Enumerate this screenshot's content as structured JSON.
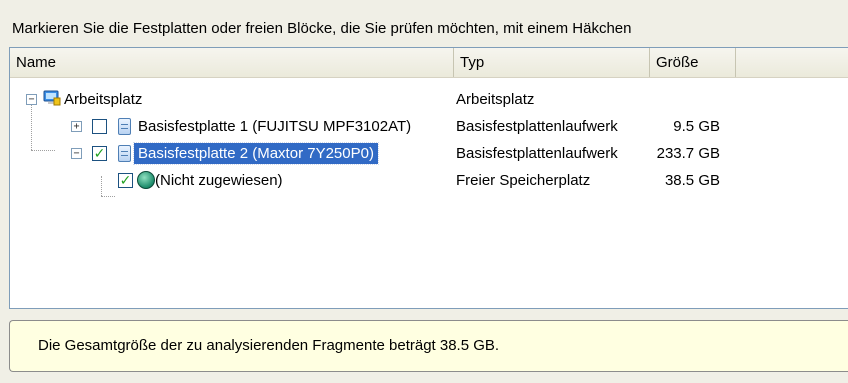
{
  "instruction": "Markieren Sie die Festplatten oder freien Blöcke, die Sie prüfen möchten, mit einem Häkchen",
  "columns": {
    "name": "Name",
    "type": "Typ",
    "size": "Größe"
  },
  "rows": [
    {
      "label": "Arbeitsplatz",
      "type": "Arbeitsplatz",
      "size": "",
      "expander": "−",
      "icon": "computer-icon",
      "checkbox": null,
      "selected": false
    },
    {
      "label": "Basisfestplatte 1 (FUJITSU MPF3102AT)",
      "type": "Basisfestplattenlaufwerk",
      "size": "9.5 GB",
      "expander": "+",
      "icon": "hard-disk-icon",
      "checkbox": false,
      "selected": false
    },
    {
      "label": "Basisfestplatte 2 (Maxtor 7Y250P0)",
      "type": "Basisfestplattenlaufwerk",
      "size": "233.7 GB",
      "expander": "−",
      "icon": "hard-disk-icon",
      "checkbox": true,
      "selected": true
    },
    {
      "label": "(Nicht zugewiesen)",
      "type": "Freier Speicherplatz",
      "size": "38.5 GB",
      "expander": null,
      "icon": "unallocated-space-icon",
      "checkbox": true,
      "selected": false
    }
  ],
  "info": {
    "message": "Die Gesamtgröße der zu analysierenden Fragmente beträgt 38.5 GB."
  },
  "colors": {
    "selection": "#316ac5",
    "info_background": "#ffffe1",
    "check": "#21a121"
  }
}
